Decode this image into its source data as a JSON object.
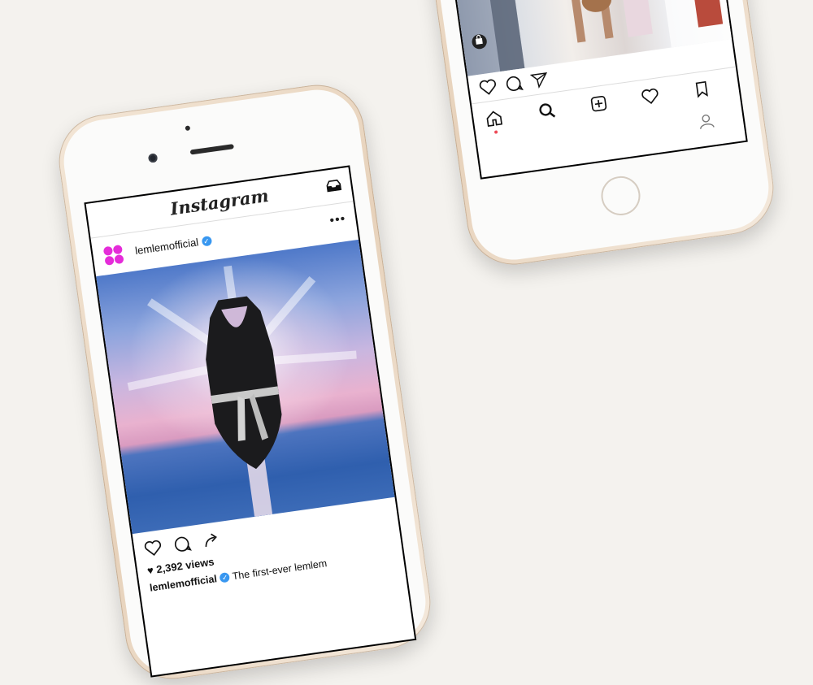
{
  "phone_left": {
    "app_title": "Instagram",
    "post": {
      "username": "lemlemofficial",
      "verified_badge": "✓",
      "more_menu": "•••",
      "views": "2,392 views",
      "caption_user": "lemlemofficial",
      "caption_text": "The first-ever lemlem"
    },
    "icons": [
      "inbox-icon",
      "heart-icon",
      "comment-icon",
      "share-icon",
      "small-heart-icon"
    ],
    "colors": {
      "avatar": "#e52cd9",
      "verified": "#3897f0"
    }
  },
  "phone_right": {
    "icons": [
      "heart-icon",
      "comment-icon",
      "send-icon",
      "home-icon",
      "search-icon",
      "add-post-icon",
      "activity-icon",
      "profile-icon",
      "bookmark-icon",
      "shopping-bag-icon"
    ]
  }
}
